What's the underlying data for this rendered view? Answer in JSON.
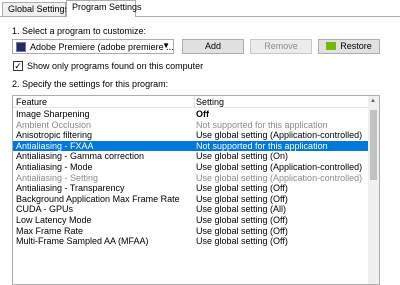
{
  "tabs": [
    {
      "label": "Global Settings",
      "active": false
    },
    {
      "label": "Program Settings",
      "active": true
    }
  ],
  "step1": {
    "label": "1. Select a program to customize:"
  },
  "program_select": {
    "value": "Adobe Premiere (adobe premiere ...",
    "icon": "premiere-app-icon"
  },
  "buttons": {
    "add": "Add",
    "remove": "Remove",
    "restore": "Restore"
  },
  "show_only_checkbox": {
    "label": "Show only programs found on this computer",
    "checked": true
  },
  "step2": {
    "label": "2. Specify the settings for this program:"
  },
  "table": {
    "headers": [
      "Feature",
      "Setting"
    ],
    "rows": [
      {
        "feature": "Image Sharpening",
        "setting": "Off",
        "state": "bold"
      },
      {
        "feature": "Ambient Occlusion",
        "setting": "Not supported for this application",
        "state": "dim"
      },
      {
        "feature": "Anisotropic filtering",
        "setting": "Use global setting (Application-controlled)",
        "state": "normal"
      },
      {
        "feature": "Antialiasing - FXAA",
        "setting": "Not supported for this application",
        "state": "selected"
      },
      {
        "feature": "Antialiasing - Gamma correction",
        "setting": "Use global setting (On)",
        "state": "normal"
      },
      {
        "feature": "Antialiasing - Mode",
        "setting": "Use global setting (Application-controlled)",
        "state": "normal"
      },
      {
        "feature": "Antialiasing - Setting",
        "setting": "Use global setting (Application-controlled)",
        "state": "dim"
      },
      {
        "feature": "Antialiasing - Transparency",
        "setting": "Use global setting (Off)",
        "state": "normal"
      },
      {
        "feature": "Background Application Max Frame Rate",
        "setting": "Use global setting (Off)",
        "state": "normal"
      },
      {
        "feature": "CUDA - GPUs",
        "setting": "Use global setting (All)",
        "state": "normal"
      },
      {
        "feature": "Low Latency Mode",
        "setting": "Use global setting (Off)",
        "state": "normal"
      },
      {
        "feature": "Max Frame Rate",
        "setting": "Use global setting (Off)",
        "state": "normal"
      },
      {
        "feature": "Multi-Frame Sampled AA (MFAA)",
        "setting": "Use global setting (Off)",
        "state": "normal"
      }
    ]
  },
  "colors": {
    "selection": "#0078d7",
    "nvidia_green": "#76b900"
  }
}
